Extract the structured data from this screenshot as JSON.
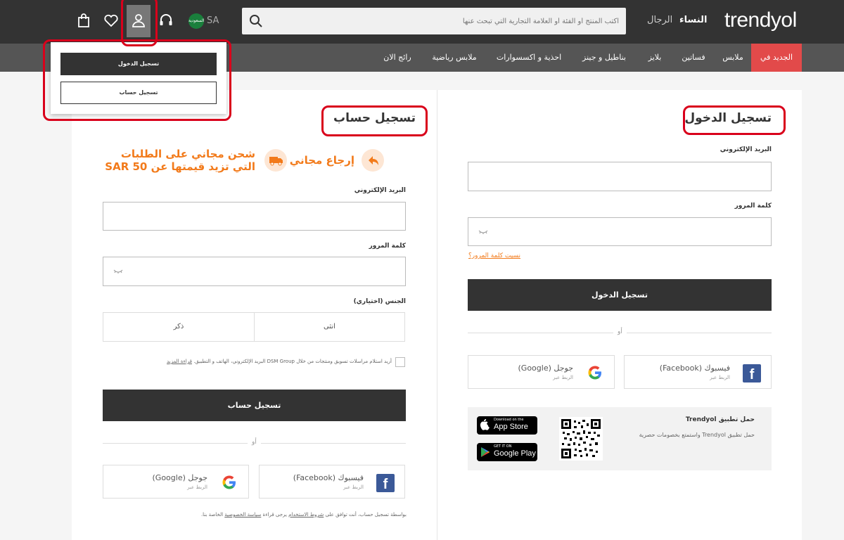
{
  "header": {
    "logo": "trendyol",
    "gender_women": "النساء",
    "gender_men": "الرجال",
    "search_placeholder": "اكتب المنتج أو الفئة أو العلامة التجارية التي تبحث عنها",
    "country_code": "SA",
    "country_flag_text": "السعودية"
  },
  "nav": {
    "items": [
      "الجديد في",
      "ملابس",
      "فساتين",
      "بلايز",
      "بناطيل و جينز",
      "احذية و اكسسوارات",
      "ملابس رياضية",
      "رائج الان"
    ]
  },
  "account_dropdown": {
    "login_label": "تسجيل الدخول",
    "register_label": "تسجيل حساب"
  },
  "register": {
    "title": "تسجيل حساب",
    "promo_return": "إرجاع مجاني",
    "promo_shipping_line1": "شحن مجاني على الطلبات",
    "promo_shipping_line2": "التي تزيد قيمتها عن SAR 50",
    "email_label": "البريد الإلكتروني",
    "password_label": "كلمة المرور",
    "gender_label": "الجنس (اختياري)",
    "gender_female": "انثى",
    "gender_male": "ذكر",
    "consent_text": "أريد استلام مراسلات تسويق ومنتجات من خلال DSM Group البريد الإلكتروني، الهاتف و التطبيق.",
    "consent_link": "قراءة المزيد",
    "submit_label": "تسجيل حساب",
    "or_label": "أو",
    "facebook_name": "فيسبوك (Facebook)",
    "facebook_sub": "الربط عبر",
    "google_name": "جوجل (Google)",
    "google_sub": "الربط عبر",
    "terms_prefix": "بواسطة تسجيل حساب، أنت توافق على",
    "terms_link": "شروط الاستخدام",
    "terms_mid": "يرجى قراءة",
    "privacy_link": "سياسة الخصوصية",
    "terms_suffix": "الخاصة بنا."
  },
  "login": {
    "title": "تسجيل الدخول",
    "email_label": "البريد الإلكتروني",
    "password_label": "كلمة المرور",
    "forgot_label": "نسيت كلمة المرور؟",
    "submit_label": "تسجيل الدخول",
    "or_label": "أو",
    "facebook_name": "فيسبوك (Facebook)",
    "facebook_sub": "الربط عبر",
    "google_name": "جوجل (Google)",
    "google_sub": "الربط عبر",
    "app_title": "حمل تطبيق Trendyol",
    "app_desc": "حمل تطبيق Trendyol واستمتع بخصومات حصرية",
    "appstore_small": "Download on the",
    "appstore_big": "App Store",
    "googleplay_small": "GET IT ON",
    "googleplay_big": "Google Play"
  },
  "colors": {
    "brand_orange": "#f27a1a",
    "highlight_red": "#d9001b",
    "nav_new_bg": "#e24a4a",
    "dark": "#333333"
  }
}
